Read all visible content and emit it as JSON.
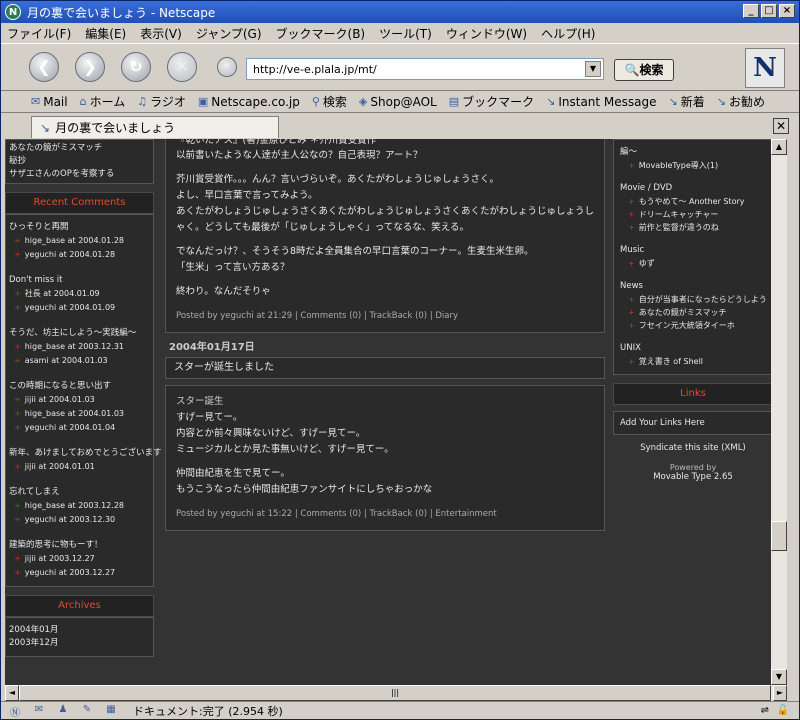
{
  "window": {
    "title": "月の裏で会いましょう - Netscape"
  },
  "menu": [
    "ファイル(F)",
    "編集(E)",
    "表示(V)",
    "ジャンプ(G)",
    "ブックマーク(B)",
    "ツール(T)",
    "ウィンドウ(W)",
    "ヘルプ(H)"
  ],
  "nav": {
    "url": "http://ve-e.plala.jp/mt/",
    "search_label": "検索"
  },
  "bookmarks": [
    "Mail",
    "ホーム",
    "ラジオ",
    "Netscape.co.jp",
    "検索",
    "Shop@AOL",
    "ブックマーク",
    "Instant Message",
    "新着",
    "お勧め"
  ],
  "tab": {
    "label": "月の裏で会いましょう"
  },
  "status": {
    "text": "ドキュメント:完了 (2.954 秒)"
  },
  "left": {
    "top_items": [
      "あなたの鏡がミスマッチ",
      "秘抄",
      "サザエさんのOPを考察する"
    ],
    "recent_heading": "Recent Comments",
    "comment_groups": [
      {
        "title": "ひっそりと再開",
        "rows": [
          "hige_base at 2004.01.28",
          "yeguchi at 2004.01.28"
        ]
      },
      {
        "title": "Don't miss it",
        "rows": [
          "社長 at 2004.01.09",
          "yeguchi at 2004.01.09"
        ]
      },
      {
        "title": "そうだ、坊主にしよう～実践編～",
        "rows": [
          "hige_base at 2003.12.31",
          "asami at 2004.01.03"
        ]
      },
      {
        "title": "この時期になると思い出す",
        "rows": [
          "jijii at 2004.01.03",
          "hige_base at 2004.01.03",
          "yeguchi at 2004.01.04"
        ]
      },
      {
        "title": "新年、あけましておめでとうございます",
        "rows": [
          "jijii at 2004.01.01"
        ]
      },
      {
        "title": "忘れてしまえ",
        "rows": [
          "hige_base at 2003.12.28",
          "yeguchi at 2003.12.30"
        ]
      },
      {
        "title": "建築的思考に物もーす！",
        "rows": [
          "jijii at 2003.12.27",
          "yeguchi at 2003.12.27"
        ]
      }
    ],
    "archives_heading": "Archives",
    "archives": [
      "2004年01月",
      "2003年12月"
    ]
  },
  "center": {
    "post1": {
      "top_partial": "『乾いたアス』(著)金原ひとみ ＊芥川賞受賞作",
      "paragraphs": [
        "以前書いたような人達が主人公なの？自己表現？アート？",
        "芥川賞受賞作。。。んん？言いづらいぞ。あくたがわしょうじゅしょうさく。\nよし、早口言葉で言ってみよう。\nあくたがわしょうじゅしょうさくあくたがわしょうじゅしょうさくあくたがわしょうじゅしょうしゃく。どうしても最後が「じゅしょうしゃく」ってなるな、笑える。",
        "でなんだっけ？、そうそう8時だよ全員集合の早口言葉のコーナー。生麦生米生卵。\n「生米」って言い方ある？",
        "終わり。なんだそりゃ"
      ],
      "footer": "Posted by yeguchi at 21:29 | Comments (0) | TrackBack (0) | Diary"
    },
    "date2": "2004年01月17日",
    "post2": {
      "title": "スターが誕生しました",
      "subtitle": "スター誕生",
      "paragraphs": [
        "すげー見てー。\n内容とか前々興味ないけど、すげー見てー。\nミュージカルとか見た事無いけど、すげー見てー。",
        "仲間由紀恵を生で見てー。\nもうこうなったら仲間由紀恵ファンサイトにしちゃおっかな"
      ],
      "footer": "Posted by yeguchi at 15:22 | Comments (0) | TrackBack (0) | Entertainment"
    }
  },
  "right": {
    "cat_top": "編～",
    "cat_top_items": [
      "MovableType導入(1)"
    ],
    "categories": [
      {
        "name": "Movie / DVD",
        "items": [
          "もうやめて～ Another Story",
          "ドリームキャッチャー",
          "前作と監督が違うのね"
        ]
      },
      {
        "name": "Music",
        "items": [
          "ゆず"
        ]
      },
      {
        "name": "News",
        "items": [
          "自分が当事者になったらどうしよう",
          "あなたの鏡がミスマッチ",
          "フセイン元大統領タイーホ"
        ]
      },
      {
        "name": "UNIX",
        "items": [
          "覚え書き of Shell"
        ]
      }
    ],
    "links_heading": "Links",
    "add_links": "Add Your Links Here",
    "syndicate": "Syndicate this site (XML)",
    "powered_by": "Powered by",
    "mt_version": "Movable Type 2.65"
  }
}
